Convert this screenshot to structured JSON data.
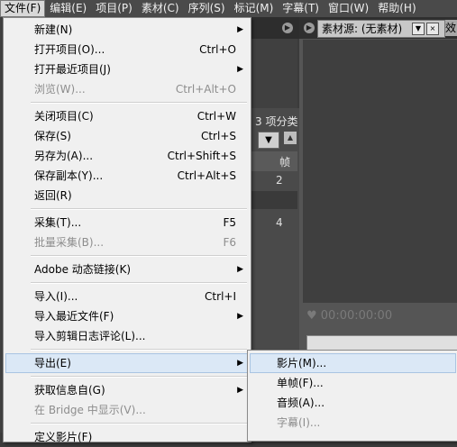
{
  "menubar": {
    "items": [
      "文件(F)",
      "编辑(E)",
      "项目(P)",
      "素材(C)",
      "序列(S)",
      "标记(M)",
      "字幕(T)",
      "窗口(W)",
      "帮助(H)"
    ]
  },
  "project_panel": {
    "bin_label": "3 项分类",
    "col_head": "帧",
    "row_value_1": "2",
    "row_value_2": "4"
  },
  "monitor": {
    "tab_label": "素材源: (无素材)",
    "tab2_label": "效",
    "timecode": "♥ 00:00:00:00"
  },
  "file_menu": {
    "items": [
      {
        "label": "新建(N)",
        "shortcut": "",
        "submenu": true,
        "disabled": false
      },
      {
        "label": "打开项目(O)...",
        "shortcut": "Ctrl+O",
        "submenu": false,
        "disabled": false
      },
      {
        "label": "打开最近项目(J)",
        "shortcut": "",
        "submenu": true,
        "disabled": false
      },
      {
        "label": "浏览(W)...",
        "shortcut": "Ctrl+Alt+O",
        "submenu": false,
        "disabled": true
      },
      {
        "label": "关闭项目(C)",
        "shortcut": "Ctrl+W",
        "submenu": false,
        "disabled": false
      },
      {
        "label": "保存(S)",
        "shortcut": "Ctrl+S",
        "submenu": false,
        "disabled": false
      },
      {
        "label": "另存为(A)...",
        "shortcut": "Ctrl+Shift+S",
        "submenu": false,
        "disabled": false
      },
      {
        "label": "保存副本(Y)...",
        "shortcut": "Ctrl+Alt+S",
        "submenu": false,
        "disabled": false
      },
      {
        "label": "返回(R)",
        "shortcut": "",
        "submenu": false,
        "disabled": false
      },
      {
        "label": "采集(T)...",
        "shortcut": "F5",
        "submenu": false,
        "disabled": false
      },
      {
        "label": "批量采集(B)...",
        "shortcut": "F6",
        "submenu": false,
        "disabled": true
      },
      {
        "label": "Adobe 动态链接(K)",
        "shortcut": "",
        "submenu": true,
        "disabled": false
      },
      {
        "label": "导入(I)...",
        "shortcut": "Ctrl+I",
        "submenu": false,
        "disabled": false
      },
      {
        "label": "导入最近文件(F)",
        "shortcut": "",
        "submenu": true,
        "disabled": false
      },
      {
        "label": "导入剪辑日志评论(L)...",
        "shortcut": "",
        "submenu": false,
        "disabled": false
      },
      {
        "label": "导出(E)",
        "shortcut": "",
        "submenu": true,
        "disabled": false
      },
      {
        "label": "获取信息自(G)",
        "shortcut": "",
        "submenu": true,
        "disabled": false
      },
      {
        "label": "在 Bridge 中显示(V)...",
        "shortcut": "",
        "submenu": false,
        "disabled": true
      },
      {
        "label": "定义影片(F)",
        "shortcut": "",
        "submenu": false,
        "disabled": false
      }
    ]
  },
  "export_submenu": {
    "items": [
      {
        "label": "影片(M)...",
        "disabled": false
      },
      {
        "label": "单帧(F)...",
        "disabled": false
      },
      {
        "label": "音频(A)...",
        "disabled": false
      },
      {
        "label": "字幕(I)...",
        "disabled": true
      }
    ]
  },
  "icons": {
    "submenu_arrow": "▶",
    "dropdown": "▼",
    "scroll_up": "▲",
    "panel_menu": "▶"
  }
}
